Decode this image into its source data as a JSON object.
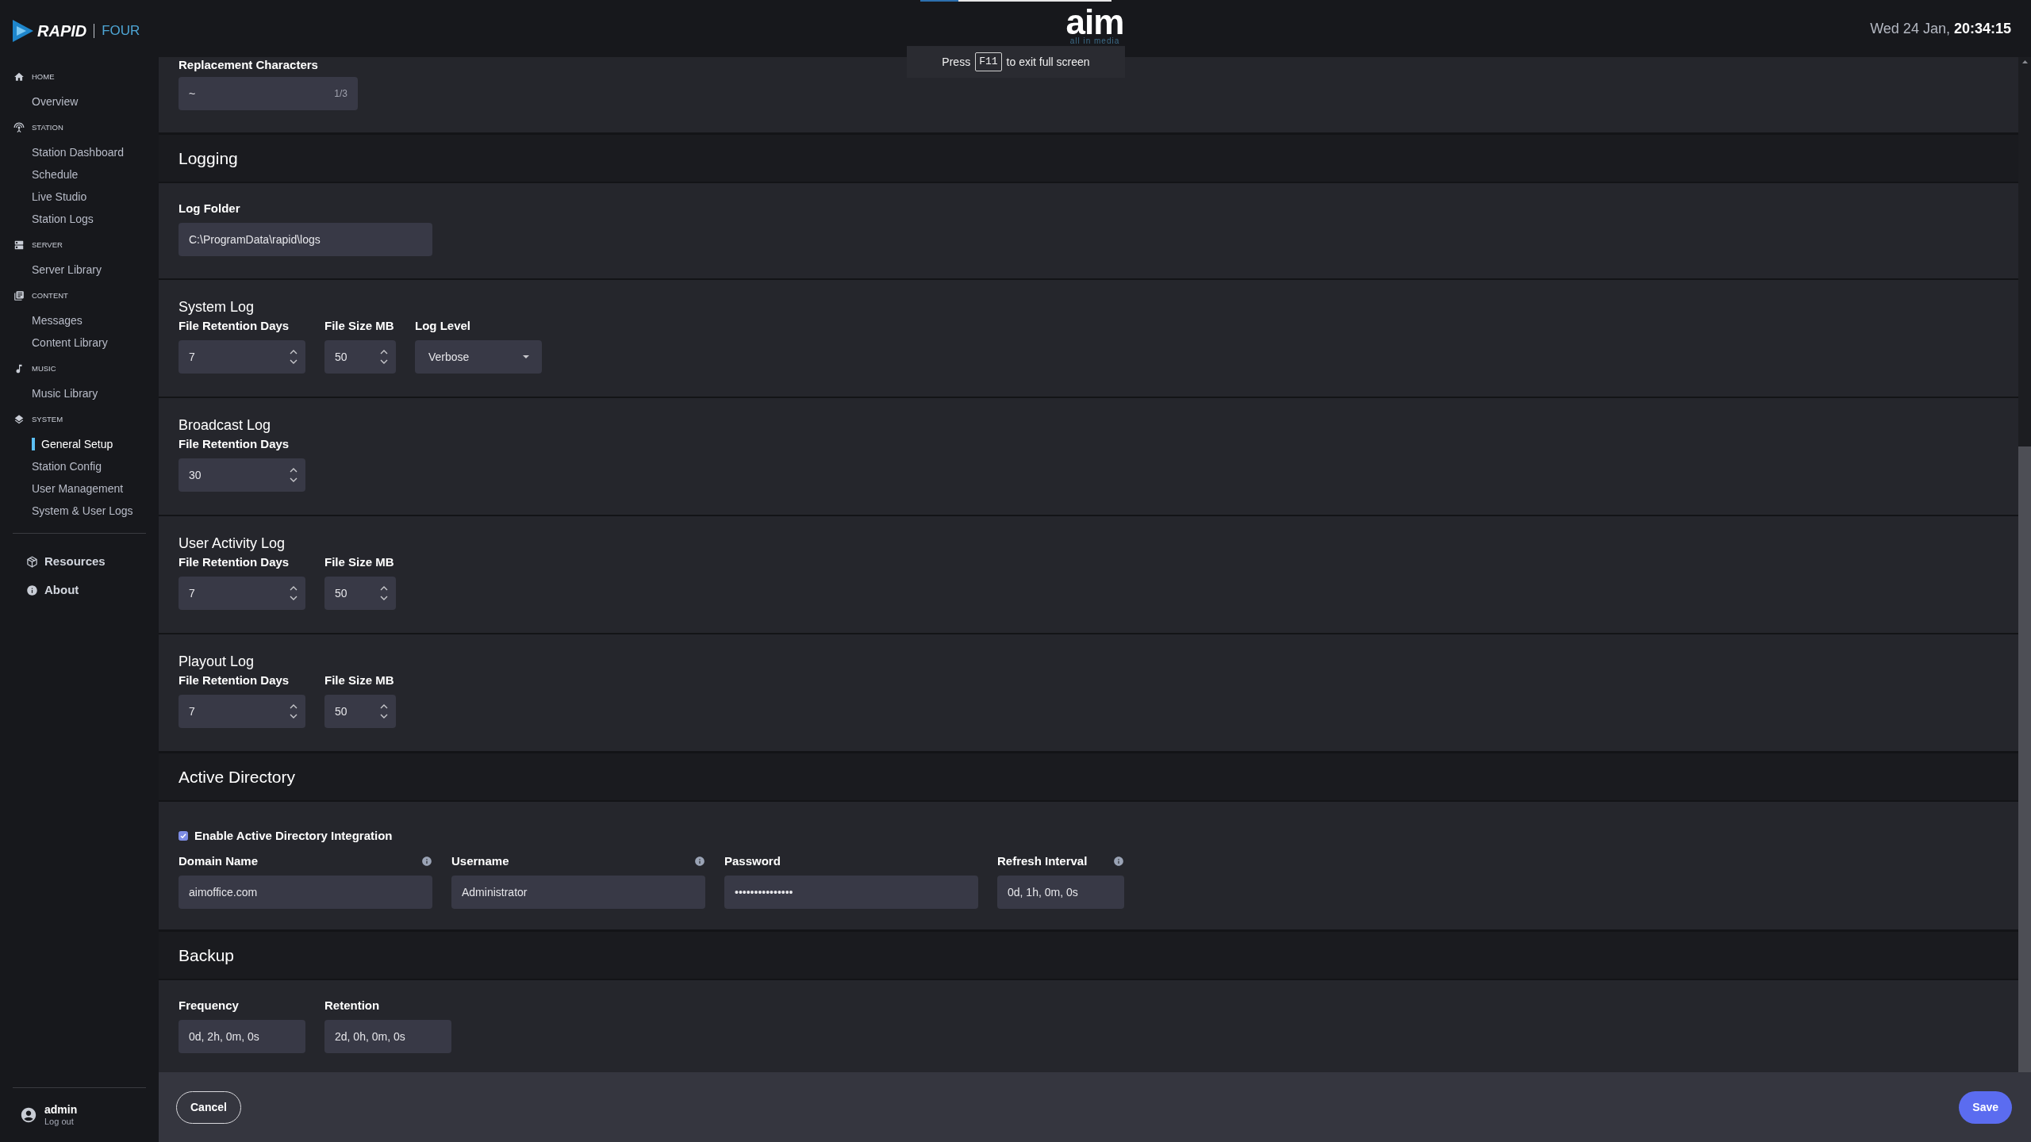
{
  "header": {
    "loading": {
      "level": 0.2
    },
    "logo": {
      "text": "aim",
      "tagline": "all in media"
    },
    "toast": {
      "before": "Press",
      "key": "F11",
      "after": "to exit full screen"
    },
    "date": "Wed 24 Jan,",
    "time": "20:34:15"
  },
  "sidebar": {
    "brand": {
      "name": "RAPID",
      "edition": "FOUR"
    },
    "groups": [
      {
        "label": "HOME",
        "items": [
          {
            "label": "Overview",
            "selected": false
          }
        ]
      },
      {
        "label": "STATION",
        "items": [
          {
            "label": "Station Dashboard",
            "selected": false
          },
          {
            "label": "Schedule",
            "selected": false
          },
          {
            "label": "Live Studio",
            "selected": false
          },
          {
            "label": "Station Logs",
            "selected": false
          }
        ]
      },
      {
        "label": "SERVER",
        "items": [
          {
            "label": "Server Library",
            "selected": false
          }
        ]
      },
      {
        "label": "CONTENT",
        "items": [
          {
            "label": "Messages",
            "selected": false
          },
          {
            "label": "Content Library",
            "selected": false
          }
        ]
      },
      {
        "label": "MUSIC",
        "items": [
          {
            "label": "Music Library",
            "selected": false
          }
        ]
      },
      {
        "label": "SYSTEM",
        "items": [
          {
            "label": "General Setup",
            "selected": true
          },
          {
            "label": "Station Config",
            "selected": false
          },
          {
            "label": "User Management",
            "selected": false
          },
          {
            "label": "System & User Logs",
            "selected": false
          }
        ]
      }
    ],
    "links": [
      "Resources",
      "About"
    ],
    "user": {
      "name": "admin",
      "action": "Log out"
    }
  },
  "content": [
    {
      "kind": "group",
      "fields": [
        {
          "kind": "counter_text",
          "label": "Replacement Characters",
          "value": "~",
          "counter": "1/3"
        }
      ]
    },
    {
      "kind": "heading",
      "title": "Logging"
    },
    {
      "kind": "group",
      "fields": [
        {
          "kind": "text",
          "label": "Log Folder",
          "value": "C:\\ProgramData\\rapid\\logs"
        }
      ]
    },
    {
      "kind": "group",
      "title": "System Log",
      "fields": [
        {
          "kind": "number",
          "label": "File Retention Days",
          "value": "7"
        },
        {
          "kind": "number",
          "label": "File Size MB",
          "value": "50"
        },
        {
          "kind": "select",
          "label": "Log Level",
          "value": "Verbose"
        }
      ]
    },
    {
      "kind": "group",
      "title": "Broadcast Log",
      "fields": [
        {
          "kind": "number",
          "label": "File Retention Days",
          "value": "30"
        }
      ]
    },
    {
      "kind": "group",
      "title": "User Activity Log",
      "fields": [
        {
          "kind": "number",
          "label": "File Retention Days",
          "value": "7"
        },
        {
          "kind": "number",
          "label": "File Size MB",
          "value": "50"
        }
      ]
    },
    {
      "kind": "group",
      "title": "Playout Log",
      "fields": [
        {
          "kind": "number",
          "label": "File Retention Days",
          "value": "7"
        },
        {
          "kind": "number",
          "label": "File Size MB",
          "value": "50"
        }
      ]
    },
    {
      "kind": "heading",
      "title": "Active Directory"
    },
    {
      "kind": "group",
      "checkbox": {
        "label": "Enable Active Directory Integration",
        "checked": true
      },
      "fields": [
        {
          "kind": "text",
          "label": "Domain Name",
          "value": "aimoffice.com",
          "info": true
        },
        {
          "kind": "text",
          "label": "Username",
          "value": "Administrator",
          "info": true
        },
        {
          "kind": "password",
          "label": "Password",
          "value": "•••••••••••••••",
          "info": false
        },
        {
          "kind": "duration",
          "label": "Refresh Interval",
          "value": "0d, 1h, 0m, 0s",
          "info": true
        }
      ]
    },
    {
      "kind": "heading",
      "title": "Backup"
    },
    {
      "kind": "group",
      "fields": [
        {
          "kind": "duration",
          "label": "Frequency",
          "value": "0d, 2h, 0m, 0s"
        },
        {
          "kind": "duration",
          "label": "Retention",
          "value": "2d, 0h, 0m, 0s"
        }
      ]
    }
  ],
  "footer": {
    "cancel": "Cancel",
    "save": "Save"
  }
}
